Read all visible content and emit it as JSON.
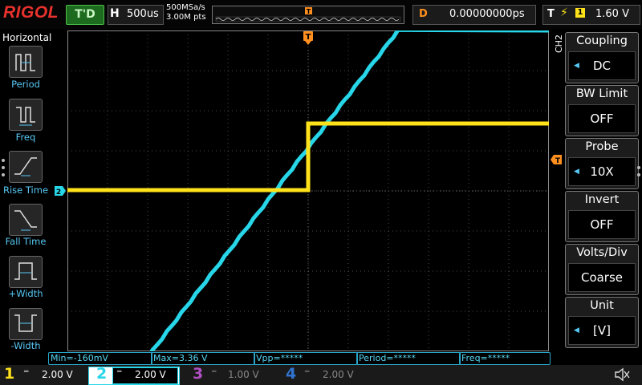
{
  "logo": "RIGOL",
  "trigger_status": "T'D",
  "timebase": {
    "label": "H",
    "value": "500us"
  },
  "sample_rate": "500MSa/s",
  "memory_depth": "3.00M pts",
  "delay": {
    "label": "D",
    "value": "0.00000000ps"
  },
  "trigger": {
    "label": "T",
    "edge": "⚡",
    "source": "1",
    "level": "1.60 V"
  },
  "left_panel": {
    "title": "Horizontal",
    "items": [
      {
        "label": "Period",
        "icon": "period-icon"
      },
      {
        "label": "Freq",
        "icon": "freq-icon"
      },
      {
        "label": "Rise Time",
        "icon": "rise-time-icon"
      },
      {
        "label": "Fall Time",
        "icon": "fall-time-icon"
      },
      {
        "label": "+Width",
        "icon": "pos-width-icon"
      },
      {
        "label": "-Width",
        "icon": "neg-width-icon"
      }
    ]
  },
  "right_panel": {
    "channel_tag": "CH2",
    "items": [
      {
        "title": "Coupling",
        "value": "DC",
        "arrow": true
      },
      {
        "title": "BW Limit",
        "value": "OFF",
        "arrow": false
      },
      {
        "title": "Probe",
        "value": "10X",
        "arrow": true
      },
      {
        "title": "Invert",
        "value": "OFF",
        "arrow": false
      },
      {
        "title": "Volts/Div",
        "value": "Coarse",
        "arrow": false
      },
      {
        "title": "Unit",
        "value": "[V]",
        "arrow": true
      }
    ]
  },
  "markers": {
    "trigger_top": "T",
    "trigger_level": "T",
    "ch2_ground": "2"
  },
  "measurements": [
    "Min=-160mV",
    "Max=3.36 V",
    "Vpp=*****",
    "Period=*****",
    "Freq=*****"
  ],
  "channels": [
    {
      "num": "1",
      "scale": "2.00 V",
      "color": "#ffe21a"
    },
    {
      "num": "2",
      "scale": "2.00 V",
      "color": "#27d6e8"
    },
    {
      "num": "3",
      "scale": "1.00 V",
      "color": "#b04fc2"
    },
    {
      "num": "4",
      "scale": "2.00 V",
      "color": "#2f74d0"
    }
  ],
  "colors": {
    "ch1_trace": "#ffe21a",
    "ch2_trace": "#27d6e8",
    "trigger": "#ff8f1f",
    "label_blue": "#57c8f5"
  }
}
